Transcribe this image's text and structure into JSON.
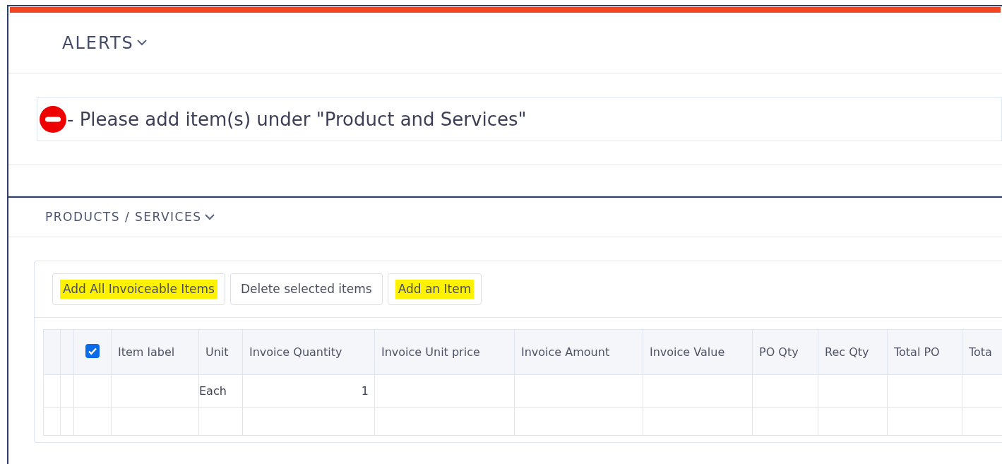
{
  "alerts": {
    "title": "ALERTS",
    "messages": [
      {
        "kind": "error",
        "text": "- Please add item(s) under \"Product and Services\""
      }
    ]
  },
  "products": {
    "title": "PRODUCTS / SERVICES",
    "buttons": [
      {
        "label": "Add All Invoiceable Items",
        "highlighted": true
      },
      {
        "label": "Delete selected items",
        "highlighted": false
      },
      {
        "label": "Add an Item",
        "highlighted": true
      }
    ],
    "table": {
      "select_all": {
        "checked": true
      },
      "columns": [
        "Item label",
        "Unit",
        "Invoice Quantity",
        "Invoice Unit price",
        "Invoice Amount",
        "Invoice Value",
        "PO Qty",
        "Rec Qty",
        "Total PO",
        "Tota"
      ],
      "rows": [
        {
          "cells": [
            "",
            "Each",
            "1",
            "",
            "",
            "",
            "",
            "",
            "",
            ""
          ]
        },
        {
          "cells": [
            "",
            "",
            "",
            "",
            "",
            "",
            "",
            "",
            "",
            ""
          ]
        }
      ]
    }
  }
}
